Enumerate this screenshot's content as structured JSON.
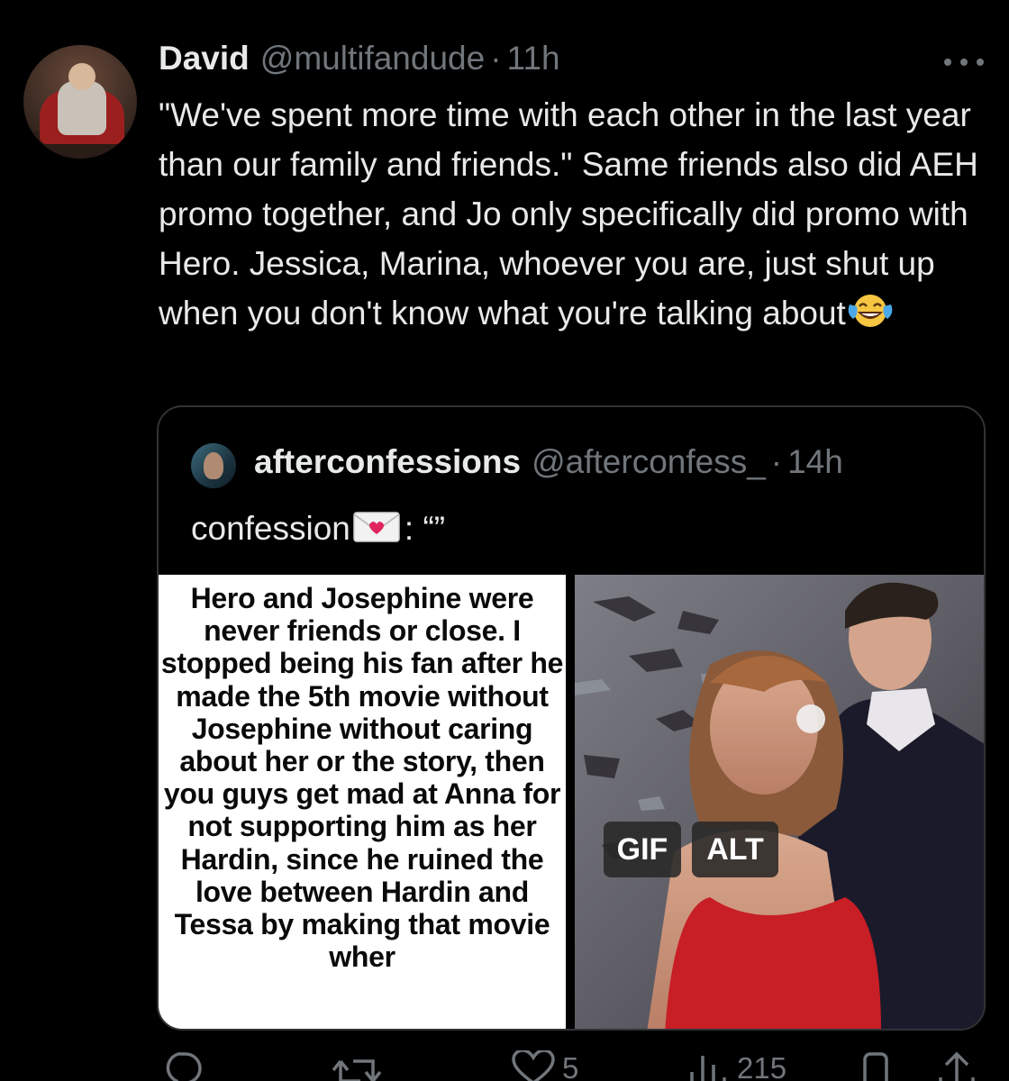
{
  "tweet": {
    "display_name": "David",
    "handle": "@multifandude",
    "dot": "·",
    "time": "11h",
    "text": "\"We've spent more time with each other in the last year than our family and friends.\" Same friends also did AEH promo together, and Jo only specifically did promo with Hero. Jessica, Marina, whoever you are, just shut up when you don't know what you're talking about",
    "emoji": "face-with-tears-of-joy"
  },
  "quote": {
    "display_name": "afterconfessions",
    "handle": "@afterconfess_",
    "dot": "·",
    "time": "14h",
    "text_prefix": "confession",
    "text_suffix": ": “”",
    "emoji": "love-letter",
    "media_text": "Hero and Josephine were never friends or close. I stopped being his fan after he made the 5th movie without Josephine without caring about her or the story, then you guys get mad at Anna for not supporting him as her Hardin, since he ruined the love between Hardin and Tessa by making that movie wher",
    "gif_label": "GIF",
    "alt_label": "ALT"
  },
  "actions": {
    "reply_count": "",
    "retweet_count": "",
    "like_count": "5",
    "views_count": "215"
  },
  "colors": {
    "background": "#000000",
    "text": "#e7e9ea",
    "muted": "#71767b",
    "border": "#2f3336"
  }
}
